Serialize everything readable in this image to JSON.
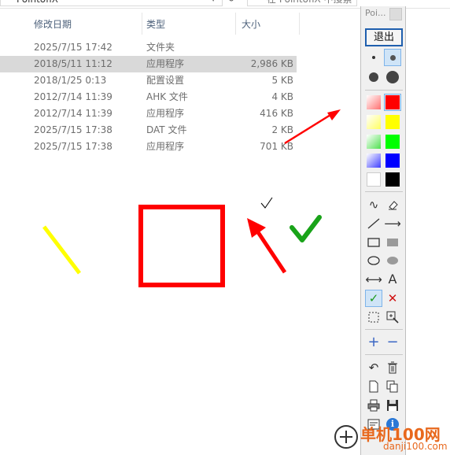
{
  "explorer": {
    "address_text": "PointofiX",
    "search_placeholder": "在 PointofiX 中搜索",
    "columns": {
      "date": "修改日期",
      "type": "类型",
      "size": "大小"
    },
    "files": [
      {
        "date": "2025/7/15 17:42",
        "type": "文件夹",
        "size": ""
      },
      {
        "date": "2018/5/11 11:12",
        "type": "应用程序",
        "size": "2,986 KB",
        "selected": true
      },
      {
        "date": "2018/1/25 0:13",
        "type": "配置设置",
        "size": "5 KB"
      },
      {
        "date": "2012/7/14 11:39",
        "type": "AHK 文件",
        "size": "4 KB"
      },
      {
        "date": "2012/7/14 11:39",
        "type": "应用程序",
        "size": "416 KB"
      },
      {
        "date": "2025/7/15 17:38",
        "type": "DAT 文件",
        "size": "2 KB"
      },
      {
        "date": "2025/7/15 17:38",
        "type": "应用程序",
        "size": "701 KB"
      }
    ]
  },
  "toolbar": {
    "title": "Poi...",
    "exit_label": "退出",
    "text_tool_glyph": "A",
    "colors": {
      "red": "#ff0000",
      "yellow": "#ffff00",
      "green": "#00ff00",
      "blue": "#0000ff",
      "white": "#ffffff",
      "black": "#000000"
    }
  },
  "drawing_colors": {
    "yellow_line": "#ffff00",
    "red": "#ff0000",
    "green_check": "#19a319"
  },
  "watermark": {
    "site_name": "单机100网",
    "url": "danji100.com"
  }
}
